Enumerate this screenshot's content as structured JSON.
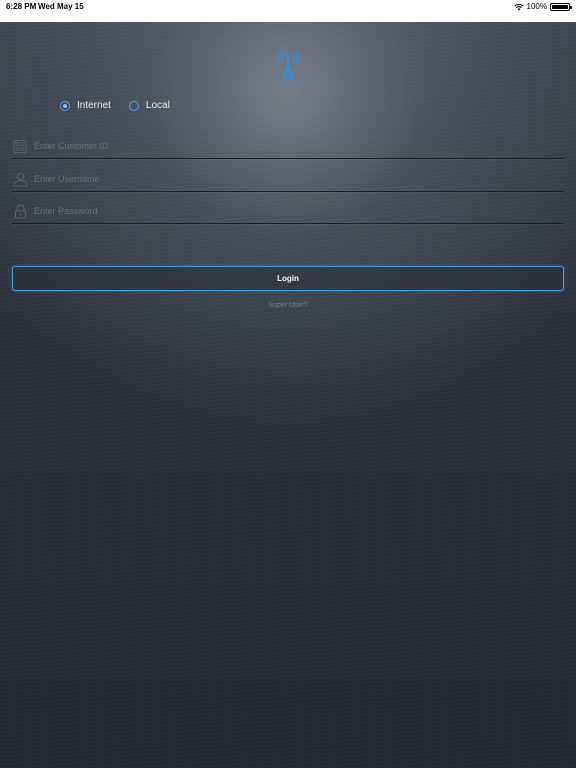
{
  "status_bar": {
    "time": "6:28 PM",
    "date": "Wed May 15",
    "battery": "100%",
    "icons": [
      "wifi-icon",
      "battery-icon"
    ]
  },
  "logo": {
    "icon": "antenna-tower-icon",
    "color": "#2f8fe0"
  },
  "connection": {
    "options": [
      {
        "label": "Internet",
        "selected": true
      },
      {
        "label": "Local",
        "selected": false
      }
    ]
  },
  "form": {
    "customer_id": {
      "placeholder": "Enter Customer ID",
      "value": "",
      "icon": "id-card-icon"
    },
    "username": {
      "placeholder": "Enter Username",
      "value": "",
      "icon": "user-icon"
    },
    "password": {
      "placeholder": "Enter Password",
      "value": "",
      "icon": "lock-icon"
    }
  },
  "login_button": {
    "label": "Login"
  },
  "super_user_link": {
    "label": "Super User?"
  },
  "colors": {
    "accent": "#3aa0e6",
    "background": "#2a2f37",
    "text": "#e9ecef",
    "placeholder": "#6b727c"
  }
}
